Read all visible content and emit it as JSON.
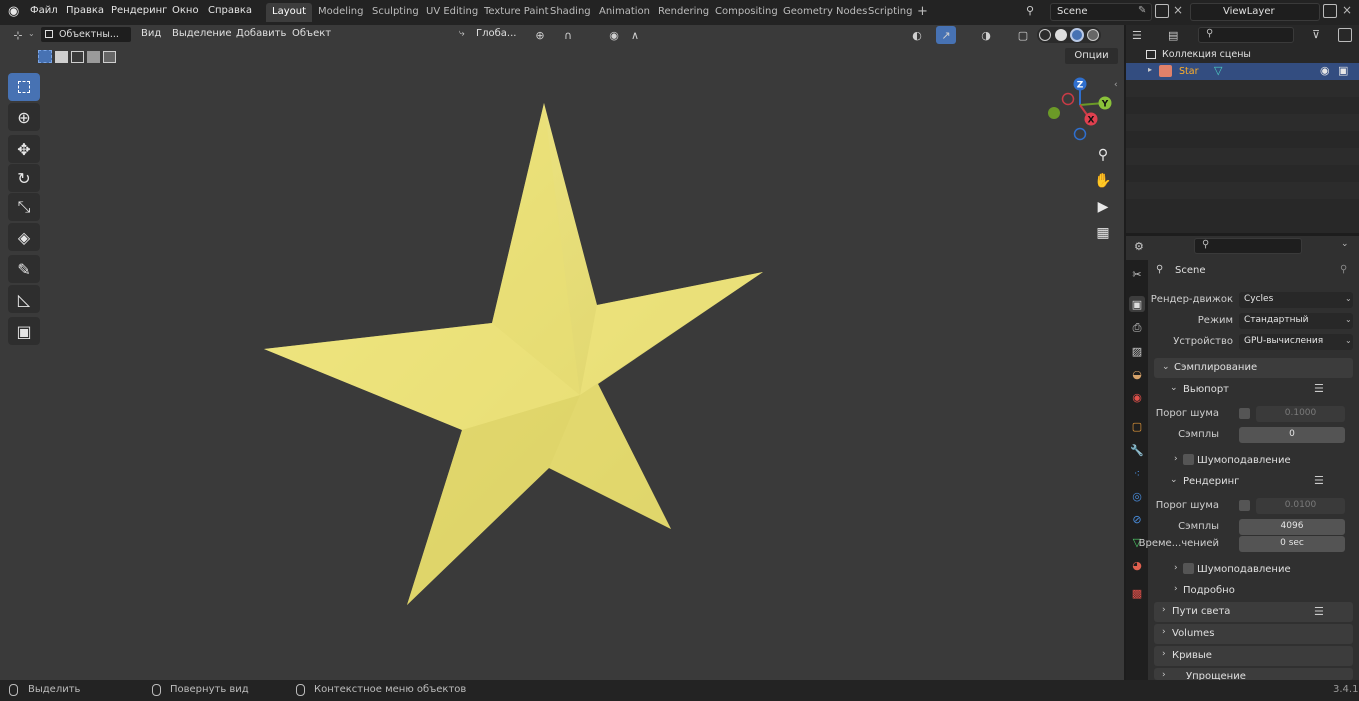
{
  "topbar": {
    "menus": [
      "Файл",
      "Правка",
      "Рендеринг",
      "Окно",
      "Справка"
    ],
    "workspaces": [
      "Layout",
      "Modeling",
      "Sculpting",
      "UV Editing",
      "Texture Paint",
      "Shading",
      "Animation",
      "Rendering",
      "Compositing",
      "Geometry Nodes",
      "Scripting"
    ],
    "add_workspace": "+",
    "scene_name": "Scene",
    "view_layer": "ViewLayer"
  },
  "viewport": {
    "mode": "Объектны...",
    "menus": [
      "Вид",
      "Выделение",
      "Добавить",
      "Объект"
    ],
    "orientation": "Глоба...",
    "options_label": "Опции",
    "object_color": "#ece27a"
  },
  "gizmo": {
    "z": "Z",
    "y": "Y",
    "x": "X"
  },
  "outliner": {
    "collection": "Коллекция сцены",
    "object": "Star"
  },
  "properties": {
    "scene": "Scene",
    "render_engine_label": "Рендер-движок",
    "render_engine": "Cycles",
    "mode_label": "Режим",
    "mode": "Стандартный",
    "device_label": "Устройство",
    "device": "GPU-вычисления",
    "sampling": "Сэмплирование",
    "viewport": "Вьюпорт",
    "noise_threshold_label": "Порог шума",
    "viewport_noise_threshold": "0.1000",
    "samples_label": "Сэмплы",
    "viewport_samples": "0",
    "denoise": "Шумоподавление",
    "render": "Рендеринг",
    "render_noise_threshold": "0.0100",
    "render_samples": "4096",
    "time_limit_label": "Време...ченией",
    "time_limit": "0 sec",
    "render_denoise": "Шумоподавление",
    "advanced": "Подробно",
    "light_paths": "Пути света",
    "volumes": "Volumes",
    "curves": "Кривые",
    "simplify": "Упрощение"
  },
  "statusbar": {
    "select": "Выделить",
    "rotate": "Повернуть вид",
    "context": "Контекстное меню объектов",
    "version": "3.4.1"
  }
}
